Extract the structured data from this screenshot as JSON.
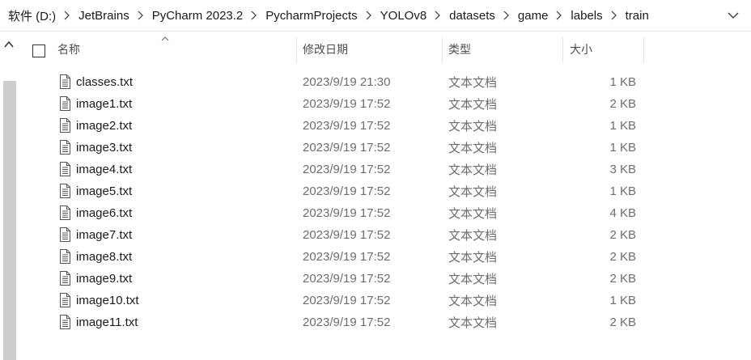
{
  "breadcrumb": [
    "软件 (D:)",
    "JetBrains",
    "PyCharm 2023.2",
    "PycharmProjects",
    "YOLOv8",
    "datasets",
    "game",
    "labels",
    "train"
  ],
  "columns": {
    "name": "名称",
    "modified": "修改日期",
    "type": "类型",
    "size": "大小"
  },
  "files": [
    {
      "name": "classes.txt",
      "modified": "2023/9/19 21:30",
      "type": "文本文档",
      "size": "1 KB"
    },
    {
      "name": "image1.txt",
      "modified": "2023/9/19 17:52",
      "type": "文本文档",
      "size": "2 KB"
    },
    {
      "name": "image2.txt",
      "modified": "2023/9/19 17:52",
      "type": "文本文档",
      "size": "1 KB"
    },
    {
      "name": "image3.txt",
      "modified": "2023/9/19 17:52",
      "type": "文本文档",
      "size": "1 KB"
    },
    {
      "name": "image4.txt",
      "modified": "2023/9/19 17:52",
      "type": "文本文档",
      "size": "3 KB"
    },
    {
      "name": "image5.txt",
      "modified": "2023/9/19 17:52",
      "type": "文本文档",
      "size": "1 KB"
    },
    {
      "name": "image6.txt",
      "modified": "2023/9/19 17:52",
      "type": "文本文档",
      "size": "4 KB"
    },
    {
      "name": "image7.txt",
      "modified": "2023/9/19 17:52",
      "type": "文本文档",
      "size": "2 KB"
    },
    {
      "name": "image8.txt",
      "modified": "2023/9/19 17:52",
      "type": "文本文档",
      "size": "2 KB"
    },
    {
      "name": "image9.txt",
      "modified": "2023/9/19 17:52",
      "type": "文本文档",
      "size": "2 KB"
    },
    {
      "name": "image10.txt",
      "modified": "2023/9/19 17:52",
      "type": "文本文档",
      "size": "1 KB"
    },
    {
      "name": "image11.txt",
      "modified": "2023/9/19 17:52",
      "type": "文本文档",
      "size": "2 KB"
    }
  ],
  "icons": {
    "file": "text-document-icon",
    "separator": "chevron-right-icon",
    "dropdown": "chevron-down-icon",
    "sort": "sort-ascending-icon",
    "scroll": "scroll-up-icon"
  }
}
